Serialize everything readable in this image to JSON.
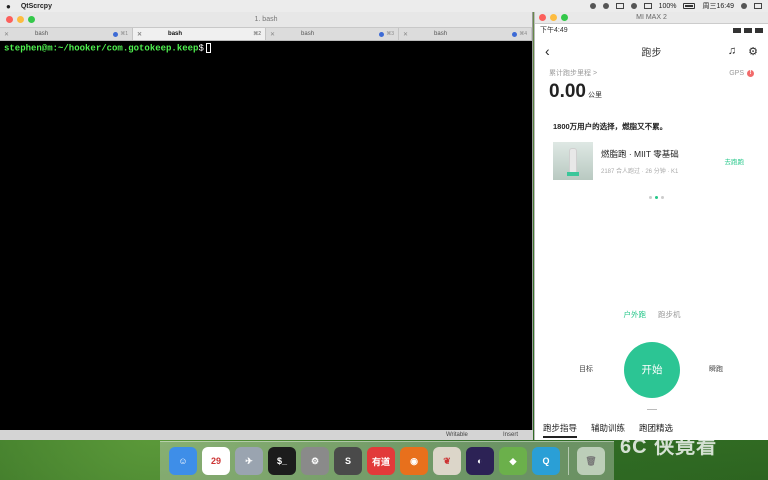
{
  "menubar": {
    "app_name": "QtScrcpy",
    "battery": "100%",
    "time": "周三16:49"
  },
  "terminal": {
    "window_title": "1. bash",
    "tabs": [
      {
        "label": "bash",
        "num": "⌘1",
        "active": false
      },
      {
        "label": "bash",
        "num": "⌘2",
        "active": true
      },
      {
        "label": "bash",
        "num": "⌘3",
        "active": false
      },
      {
        "label": "bash",
        "num": "⌘4",
        "active": false
      }
    ],
    "prompt_user": "stephen@m",
    "prompt_path": ":~/hooker/com.gotokeep.keep",
    "prompt_symbol": "$",
    "status_writable": "Writable",
    "status_insert": "Insert"
  },
  "phone": {
    "window_title": "MI MAX 2",
    "status_time": "下午4:49",
    "app_title": "跑步",
    "accumulated_label": "累计跑步里程 >",
    "gps_label": "GPS",
    "distance_value": "0.00",
    "distance_unit": "公里",
    "promo_text": "1800万用户的选择，燃脂又不累。",
    "course": {
      "name": "燃脂跑 · MIIT 零基础",
      "meta": "2187 合人跑过 · 26 分钟 · K1",
      "link": "去跑跑"
    },
    "modes": {
      "outdoor": "户外跑",
      "treadmill": "跑步机"
    },
    "target_label": "目标",
    "start_label": "开始",
    "settings_label": "瞬跑",
    "bottom_tabs": [
      "跑步指导",
      "辅助训练",
      "跑团精选"
    ]
  },
  "dock": {
    "apps": [
      {
        "icon": "finder-icon",
        "text": "☺",
        "color": "#3e8ee8"
      },
      {
        "icon": "calendar-icon",
        "text": "29",
        "color": "#ffffff"
      },
      {
        "icon": "launchpad-icon",
        "text": "✈",
        "color": "#9aa4b0"
      },
      {
        "icon": "terminal-icon",
        "text": "$_",
        "color": "#1c1c1c"
      },
      {
        "icon": "system-prefs-icon",
        "text": "⚙",
        "color": "#8a8a8a"
      },
      {
        "icon": "sublime-icon",
        "text": "S",
        "color": "#4a4a4a"
      },
      {
        "icon": "youdao-icon",
        "text": "有道",
        "color": "#e23a3a"
      },
      {
        "icon": "firefox-icon",
        "text": "◉",
        "color": "#e8701c"
      },
      {
        "icon": "preview-icon",
        "text": "❦",
        "color": "#dcd6c9"
      },
      {
        "icon": "eclipse-icon",
        "text": "◐",
        "color": "#2c2255"
      },
      {
        "icon": "android-studio-icon",
        "text": "◆",
        "color": "#6bb04b"
      },
      {
        "icon": "qtscrcpy-icon",
        "text": "Q",
        "color": "#2a9fd6"
      }
    ],
    "trash_icon": "trash-icon"
  },
  "watermark": "6C 侠竟看"
}
